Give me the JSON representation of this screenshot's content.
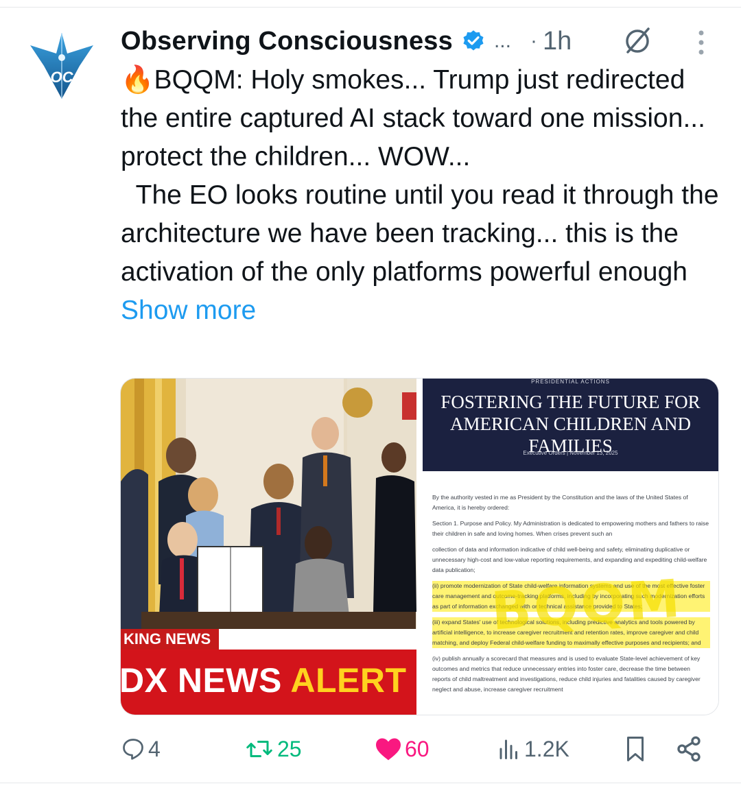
{
  "author": {
    "display_name": "Observing Consciousness",
    "avatar_initials": "OC",
    "verified_icon": "verified-badge-icon",
    "overflow": "...",
    "dot": "·",
    "time": "1h"
  },
  "post": {
    "text": "🔥BQQM: Holy smokes... Trump just redirected the entire captured AI stack toward one mission... protect the children... WOW...\n  The EO looks routine until you read it through the architecture we have been tracking... this is the activation of the only platforms powerful enough ",
    "show_more": "Show more"
  },
  "media": {
    "left_photo": {
      "ticker_tag": "KING NEWS",
      "alert_white": "DX NEWS ",
      "alert_yellow": "ALERT"
    },
    "right_doc": {
      "kicker": "PRESIDENTIAL ACTIONS",
      "title_line1": "FOSTERING THE FUTURE FOR",
      "title_line2": "AMERICAN CHILDREN AND FAMILIES",
      "meta": "Executive Orders  |  November 13, 2025",
      "para1": "By the authority vested in me as President by the Constitution and the laws of the United States of America, it is hereby ordered:",
      "para2": "Section 1. Purpose and Policy. My Administration is dedicated to empowering mothers and fathers to raise their children in safe and loving homes. When crises prevent such an",
      "para3": "collection of data and information indicative of child well-being and safety, eliminating duplicative or unnecessary high-cost and low-value reporting requirements, and expanding and expediting child-welfare data publication;",
      "para4": "(ii) promote modernization of State child-welfare information systems and use of the most effective foster care management and outcome-tracking platforms, including by incorporating such modernization efforts as part of information exchanged with or technical assistance provided to States;",
      "para5": "(iii) expand States' use of technological solutions, including predictive analytics and tools powered by artificial intelligence, to increase caregiver recruitment and retention rates, improve caregiver and child matching, and deploy Federal child-welfare funding to maximally effective purposes and recipients; and",
      "para6": "(iv) publish annually a scorecard that measures and is used to evaluate State-level achievement of key outcomes and metrics that reduce unnecessary entries into foster care, decrease the time between reports of child maltreatment and investigations, reduce child injuries and fatalities caused by caregiver neglect and abuse, increase caregiver recruitment",
      "overlay_text": "BQQM"
    }
  },
  "actions": {
    "replies": "4",
    "reposts": "25",
    "likes": "60",
    "views": "1.2K"
  },
  "colors": {
    "link": "#1d9bf0",
    "repost_green": "#00ba7c",
    "like_pink": "#f91880",
    "muted": "#536471",
    "verified_blue": "#1d9bf0"
  }
}
